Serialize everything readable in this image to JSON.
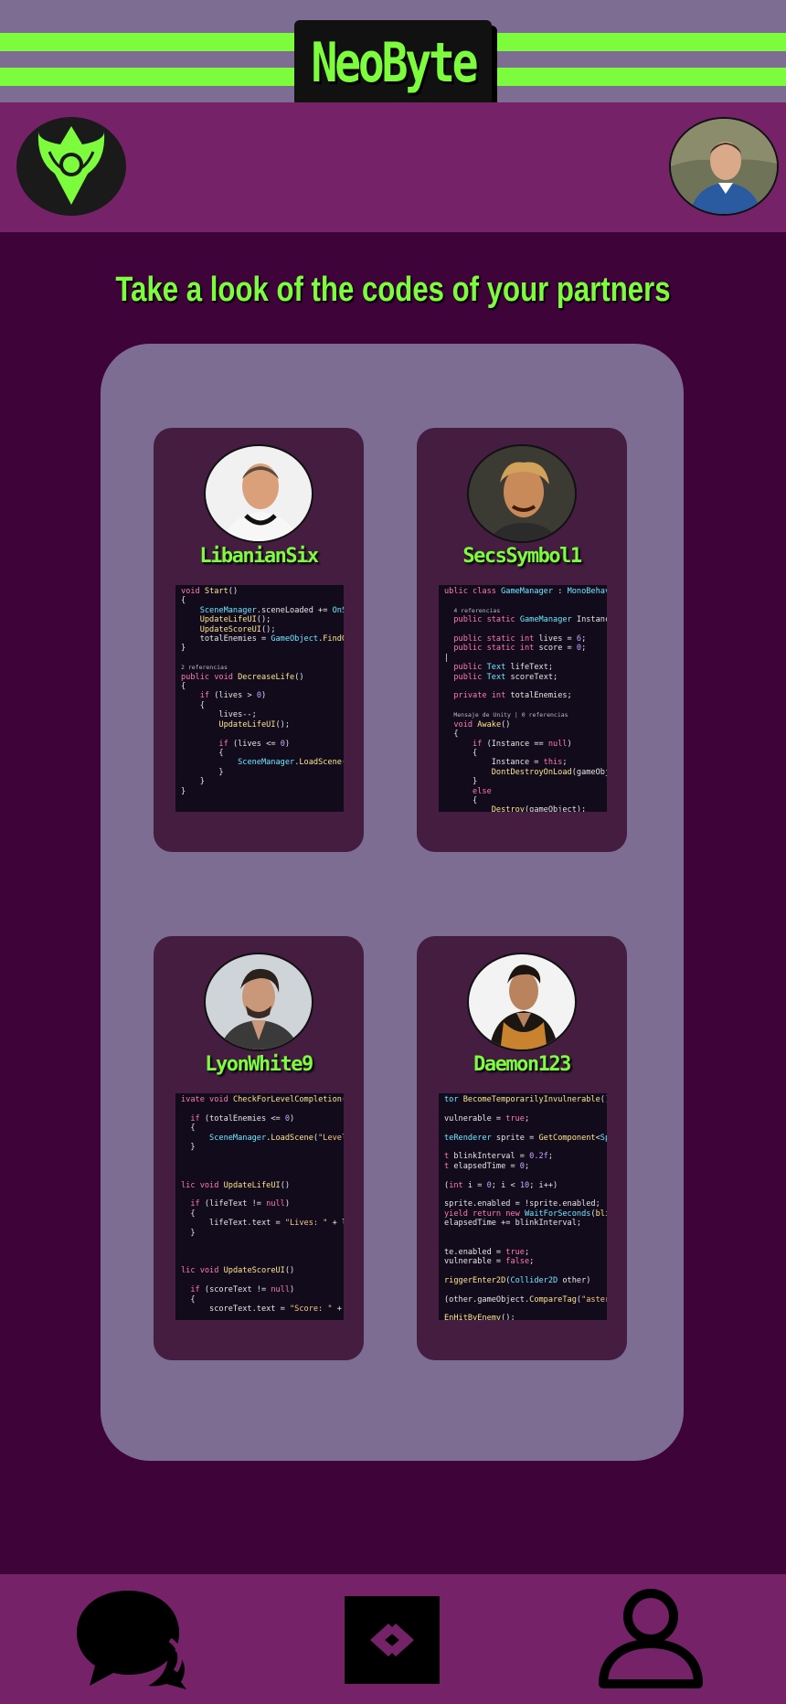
{
  "app": {
    "brand": "NeoByte",
    "colors": {
      "accent": "#7cfc3c",
      "background": "#3e0439",
      "header": "#762269",
      "panel": "#7e6d93",
      "card": "#441d41"
    }
  },
  "header": {
    "logo_icon": "neobyte-emblem-icon",
    "profile_avatar": "user-avatar"
  },
  "main": {
    "heading": "Take a look of the codes of your partners",
    "partners": [
      {
        "username": "LibanianSix"
      },
      {
        "username": "SecsSymbol1"
      },
      {
        "username": "LyonWhite9"
      },
      {
        "username": "Daemon123"
      }
    ]
  },
  "nav": {
    "items": [
      {
        "icon": "chat-icon"
      },
      {
        "icon": "code-icon"
      },
      {
        "icon": "profile-icon"
      }
    ]
  }
}
